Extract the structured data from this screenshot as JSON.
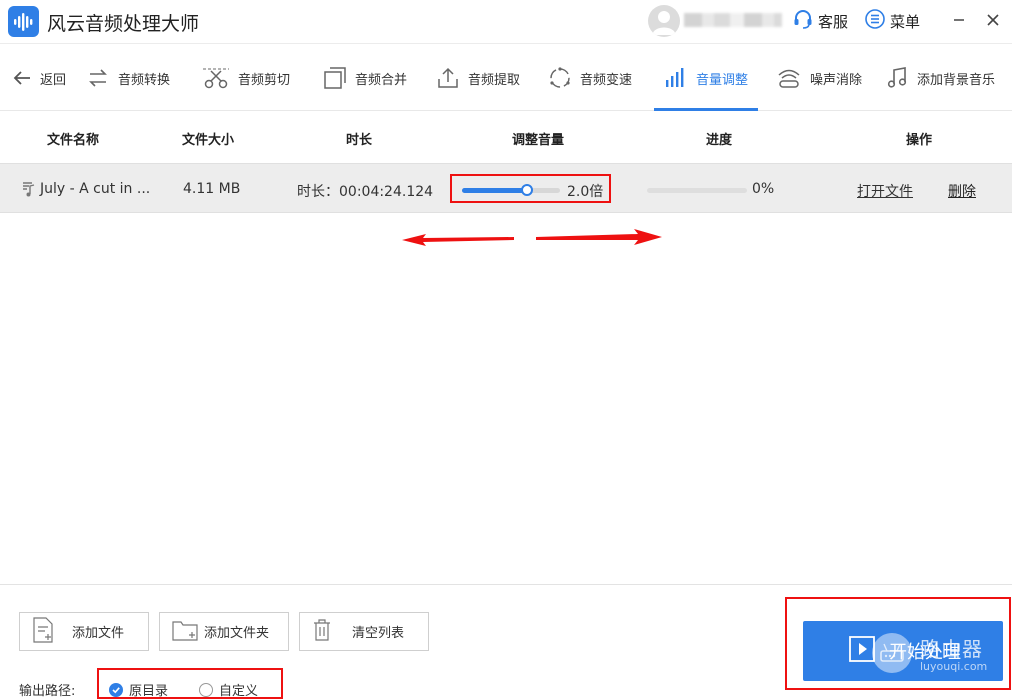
{
  "app": {
    "title": "风云音频处理大师"
  },
  "titlebar": {
    "service_label": "客服",
    "menu_label": "菜单"
  },
  "toolbar": {
    "back_label": "返回",
    "tools": [
      {
        "label": "音频转换",
        "icon": "swap-arrows-icon"
      },
      {
        "label": "音频剪切",
        "icon": "scissors-icon"
      },
      {
        "label": "音频合并",
        "icon": "merge-squares-icon"
      },
      {
        "label": "音频提取",
        "icon": "upload-tray-icon"
      },
      {
        "label": "音频变速",
        "icon": "speed-circle-icon"
      },
      {
        "label": "音量调整",
        "icon": "volume-bars-icon",
        "active": true
      },
      {
        "label": "噪声消除",
        "icon": "noise-wave-icon"
      },
      {
        "label": "添加背景音乐",
        "icon": "music-note-icon"
      }
    ]
  },
  "table": {
    "headers": {
      "name": "文件名称",
      "size": "文件大小",
      "duration": "时长",
      "volume": "调整音量",
      "progress": "进度",
      "actions": "操作"
    },
    "rows": [
      {
        "name": "July - A cut in ...",
        "size": "4.11 MB",
        "duration": "时长：00:04:24.124",
        "volume_label": "2.0倍",
        "volume_fraction": 0.66,
        "progress_label": "0%",
        "progress_fraction": 0,
        "open_label": "打开文件",
        "delete_label": "删除"
      }
    ]
  },
  "bottom": {
    "add_file": "添加文件",
    "add_folder": "添加文件夹",
    "clear_list": "清空列表",
    "output_label": "输出路径:",
    "option_original": "原目录",
    "option_custom": "自定义",
    "start_label": "开始处理"
  },
  "watermark": {
    "main": "路由器",
    "sub": "luyouqi.com"
  },
  "colors": {
    "accent": "#2f7fe6",
    "annotation": "#e11111"
  }
}
